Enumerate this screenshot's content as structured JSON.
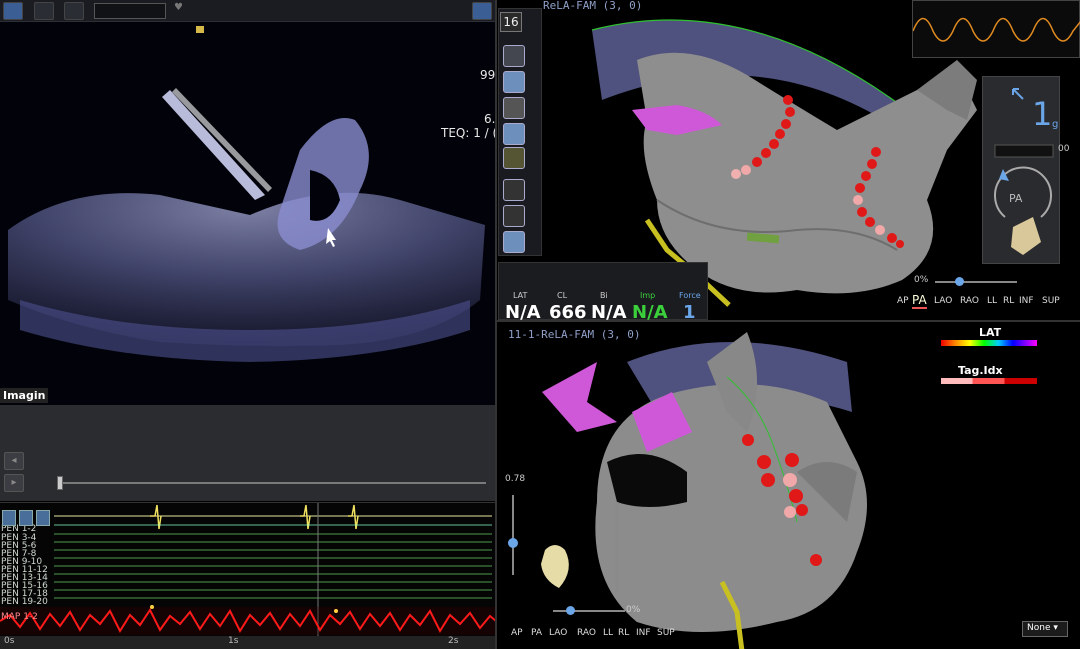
{
  "ultrasound": {
    "overlay_99": "99",
    "overlay_6": "6.",
    "teq": "TEQ: 1 / (",
    "imaging_label": "Imagin"
  },
  "ecg": {
    "channels": [
      "PEN 1-2",
      "PEN 3-4",
      "PEN 5-6",
      "PEN 7-8",
      "PEN 9-10",
      "PEN 11-12",
      "PEN 13-14",
      "PEN 15-16",
      "PEN 17-18",
      "PEN 19-20"
    ],
    "map_label": "MAP 1-2",
    "axis": [
      "0s",
      "1s",
      "2s"
    ]
  },
  "map_top": {
    "title": "ReLA-FAM (3, 0)",
    "count": "16",
    "zoom": "0%",
    "views": [
      "AP",
      "PA",
      "LAO",
      "RAO",
      "LL",
      "RL",
      "INF",
      "SUP"
    ],
    "active_view": "PA"
  },
  "map_bottom": {
    "title": "11-1-ReLA-FAM (3, 0)",
    "zoom": "0%",
    "scale_value": "0.78",
    "views": [
      "AP",
      "PA",
      "LAO",
      "RAO",
      "LL",
      "RL",
      "INF",
      "SUP"
    ],
    "legend_lat": "LAT",
    "legend_tag": "Tag.Idx",
    "select": "None"
  },
  "readout": {
    "labels": [
      "LAT",
      "CL",
      "Bi",
      "Imp",
      "Force"
    ],
    "values": [
      "N/A",
      "666",
      "N/A",
      "N/A",
      "1"
    ],
    "colors": [
      "#ffffff",
      "#ffffff",
      "#ffffff",
      "#3ccf3c",
      "#6aa6e8"
    ]
  },
  "force": {
    "value": "1",
    "unit": "g",
    "orientation": "PA",
    "side_num": "00"
  },
  "colors": {
    "accent": "#6aa6e8",
    "imp": "#3ccf3c",
    "tag_red": "#cc0000",
    "mesh": "#8c8c8c",
    "ultrasound": "#8b8fd0"
  }
}
